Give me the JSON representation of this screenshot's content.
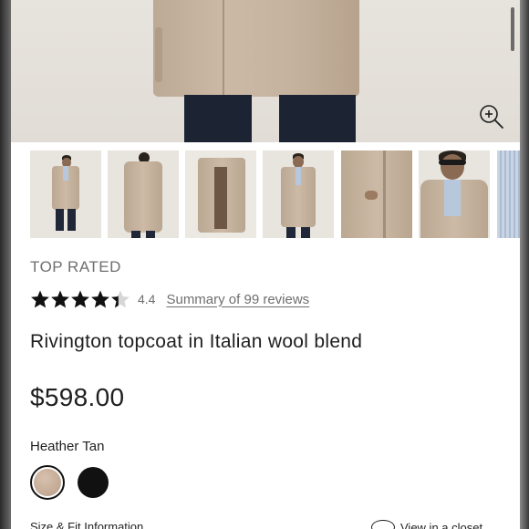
{
  "hero": {
    "zoom_icon": "zoom-in-icon"
  },
  "thumbnails": [
    {
      "name": "full-front-view"
    },
    {
      "name": "back-view"
    },
    {
      "name": "flat-lay-open"
    },
    {
      "name": "front-view-2"
    },
    {
      "name": "pocket-detail"
    },
    {
      "name": "upper-body-sunglasses"
    },
    {
      "name": "partial-next"
    }
  ],
  "product": {
    "badge": "TOP RATED",
    "rating": 4.4,
    "rating_text": "4.4",
    "stars": {
      "full": 4,
      "fraction": 0.4,
      "max": 5
    },
    "reviews_link": "Summary of 99 reviews",
    "title": "Rivington topcoat in Italian wool blend",
    "price": "$598.00",
    "selected_color": "Heather Tan",
    "colors": [
      {
        "name": "Heather Tan",
        "hex": "#c4ab96",
        "selected": true
      },
      {
        "name": "Black",
        "hex": "#111111",
        "selected": false
      }
    ]
  },
  "footer": {
    "size_fit": "Size & Fit Information",
    "view_link": "View in a closet"
  },
  "colors": {
    "text": "#1f1f1f",
    "muted": "#6f6f6f",
    "star": "#111111"
  }
}
